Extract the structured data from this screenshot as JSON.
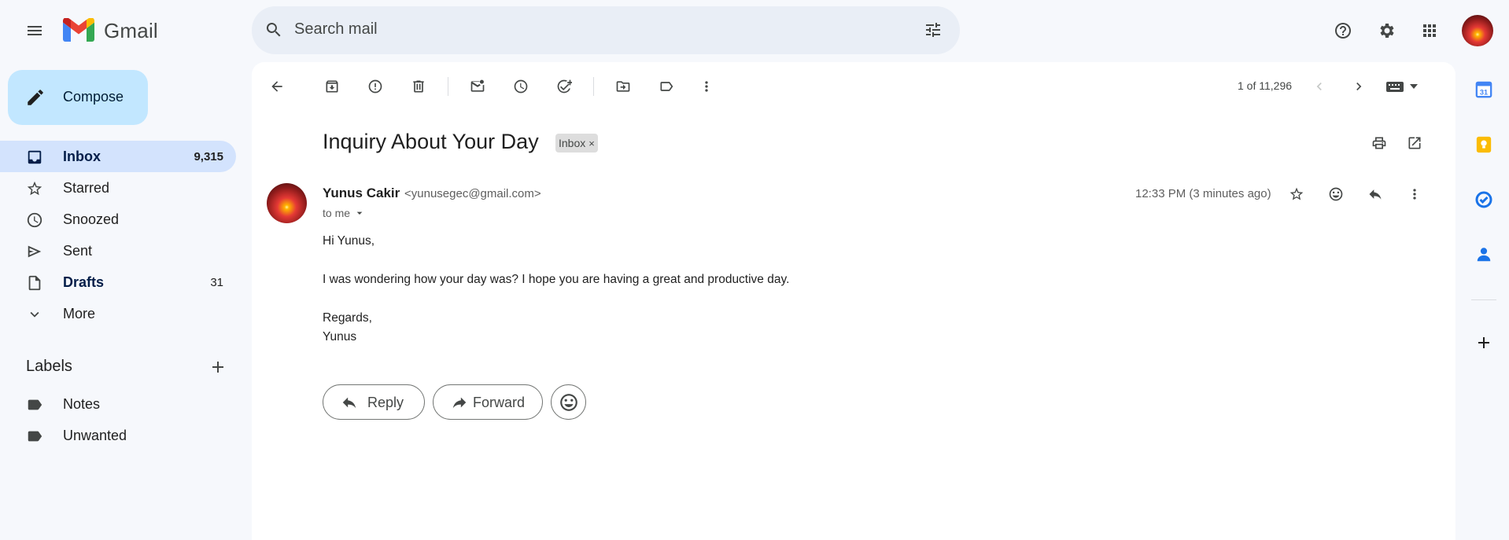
{
  "header": {
    "logo_text": "Gmail",
    "search_placeholder": "Search mail",
    "icons": [
      "menu-icon",
      "gmail-logo",
      "search-icon",
      "search-options-icon",
      "help-icon",
      "settings-icon",
      "apps-icon",
      "account-avatar"
    ]
  },
  "sidebar": {
    "compose_label": "Compose",
    "items": [
      {
        "label": "Inbox",
        "count": "9,315",
        "icon": "inbox-icon",
        "active": true
      },
      {
        "label": "Starred",
        "count": "",
        "icon": "star-icon"
      },
      {
        "label": "Snoozed",
        "count": "",
        "icon": "clock-icon"
      },
      {
        "label": "Sent",
        "count": "",
        "icon": "send-icon"
      },
      {
        "label": "Drafts",
        "count": "31",
        "icon": "draft-icon",
        "bold": true
      },
      {
        "label": "More",
        "count": "",
        "icon": "chevron-down-icon"
      }
    ],
    "labels_title": "Labels",
    "labels": [
      {
        "label": "Notes",
        "icon": "label-icon"
      },
      {
        "label": "Unwanted",
        "icon": "label-icon"
      }
    ]
  },
  "toolbar": {
    "pager": "1 of 11,296",
    "icons": [
      "back-icon",
      "archive-icon",
      "report-spam-icon",
      "delete-icon",
      "mark-unread-icon",
      "snooze-icon",
      "add-task-icon",
      "move-to-icon",
      "labels-icon",
      "more-vert-icon",
      "older-icon",
      "newer-icon",
      "keyboard-icon"
    ]
  },
  "message": {
    "subject": "Inquiry About Your Day",
    "tag": "Inbox",
    "tag_close": "×",
    "sender_name": "Yunus Cakir",
    "sender_email": "<yunusegec@gmail.com>",
    "recipient": "to me",
    "timestamp": "12:33 PM (3 minutes ago)",
    "body": {
      "greeting": "Hi Yunus,",
      "text": "I was wondering how your day was? I hope you are having a great and productive day.",
      "closing": "Regards,",
      "signature": "Yunus"
    }
  },
  "actions": {
    "reply_label": "Reply",
    "forward_label": "Forward"
  },
  "side_panel": {
    "icons": [
      "calendar-icon",
      "keep-icon",
      "tasks-icon",
      "contacts-icon",
      "add-addon-icon"
    ],
    "calendar_day": "31"
  },
  "colors": {
    "background": "#f6f8fc",
    "compose_bg": "#c2e7ff",
    "active_nav_bg": "#d3e3fd",
    "search_bg": "#e9eef6",
    "calendar_blue": "#4285f4",
    "keep_yellow": "#fbbc04",
    "contacts_blue": "#1a73e8"
  }
}
